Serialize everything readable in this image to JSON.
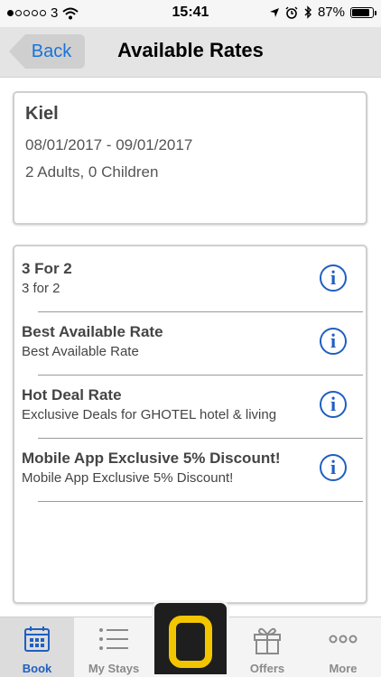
{
  "status_bar": {
    "carrier": "3",
    "time": "15:41",
    "battery": "87%",
    "battery_level": 0.87,
    "signal_bars_filled": 1,
    "signal_bars_total": 5
  },
  "navbar": {
    "back_label": "Back",
    "title": "Available Rates"
  },
  "summary": {
    "city": "Kiel",
    "dates": "08/01/2017 - 09/01/2017",
    "guests": "2 Adults, 0 Children"
  },
  "rates": [
    {
      "name": "3 For 2",
      "description": "3 for 2"
    },
    {
      "name": "Best Available Rate",
      "description": "Best Available Rate"
    },
    {
      "name": "Hot Deal Rate",
      "description": "Exclusive Deals for GHOTEL hotel & living"
    },
    {
      "name": "Mobile App Exclusive 5% Discount!",
      "description": "Mobile App Exclusive 5% Discount!"
    }
  ],
  "info_glyph": "i",
  "tabbar": {
    "tabs": [
      {
        "label": "Book",
        "icon": "calendar-icon",
        "active": true
      },
      {
        "label": "My Stays",
        "icon": "list-icon",
        "active": false
      },
      {
        "label": "",
        "icon": "logo-icon",
        "active": false
      },
      {
        "label": "Offers",
        "icon": "gift-icon",
        "active": false
      },
      {
        "label": "More",
        "icon": "more-icon",
        "active": false
      }
    ]
  },
  "colors": {
    "accent": "#1f5fc0",
    "back_text": "#1a73d9",
    "logo_yellow": "#f2c500"
  }
}
